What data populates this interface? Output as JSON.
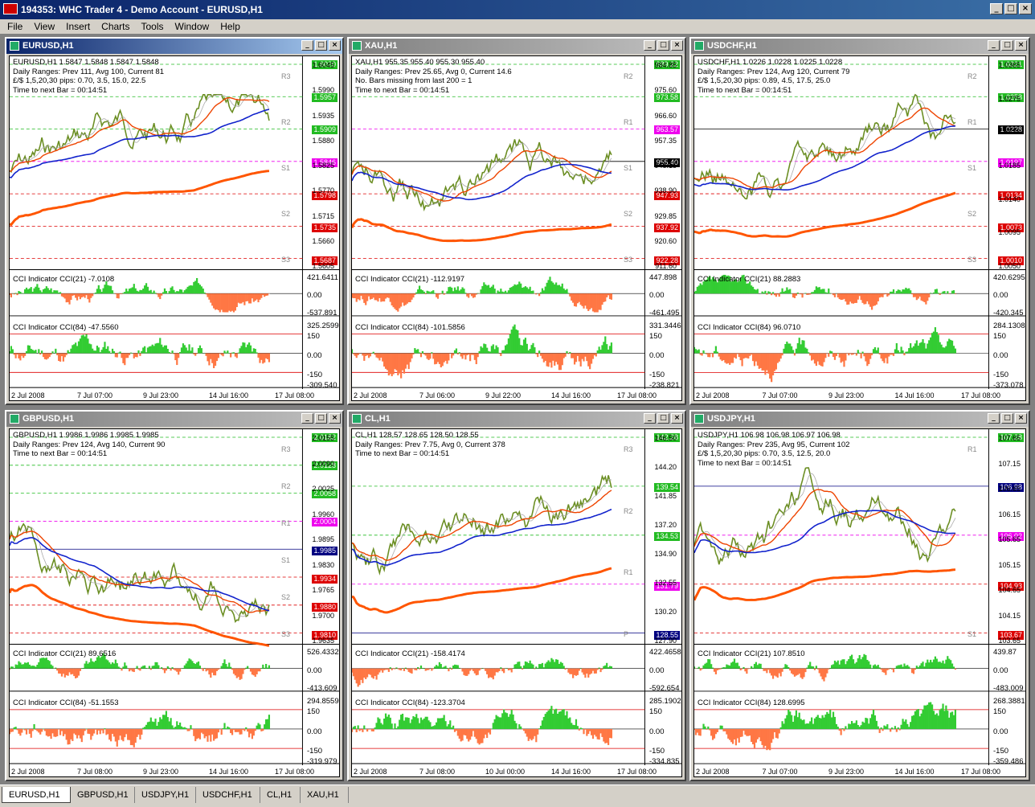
{
  "app": {
    "title": "194353: WHC Trader 4 - Demo Account - EURUSD,H1"
  },
  "menu": [
    "File",
    "View",
    "Insert",
    "Charts",
    "Tools",
    "Window",
    "Help"
  ],
  "tabs": [
    "EURUSD,H1",
    "GBPUSD,H1",
    "USDJPY,H1",
    "USDCHF,H1",
    "CL,H1",
    "XAU,H1"
  ],
  "charts": [
    {
      "title": "EURUSD,H1",
      "info": [
        "EURUSD,H1  1.5847 1.5848 1.5847 1.5848",
        "Daily Ranges:  Prev 111,  Avg 100,  Current 81",
        "£/$  1,5,20,30 pips:  0.70,  3.5,  15.0,  22.5",
        "Time to next Bar = 00:14:51"
      ],
      "yticks": [
        "1.6045",
        "1.5990",
        "1.5935",
        "1.5880",
        "1.5825",
        "1.5770",
        "1.5715",
        "1.5660",
        "1.5605"
      ],
      "levels": [
        {
          "v": "1.6020",
          "c": "#22bb22"
        },
        {
          "v": "1.5957",
          "c": "#22bb22"
        },
        {
          "v": "1.5909",
          "c": "#22bb22"
        },
        {
          "v": "1.5846",
          "c": "#ee00ee"
        },
        {
          "v": "1.5798",
          "c": "#dd0000"
        },
        {
          "v": "1.5735",
          "c": "#dd0000"
        },
        {
          "v": "1.5687",
          "c": "#dd0000"
        }
      ],
      "pivots": [
        "R3",
        "R2",
        "S1",
        "S2",
        "S3"
      ],
      "cci1": {
        "label": "CCI Indicator  CCI(21) -7.0108",
        "hi": "421.6411",
        "mid": "0.00",
        "lo": "-537.891"
      },
      "cci2": {
        "label": "CCI Indicator  CCI(84) -47.5560",
        "hi": "325.2599",
        "l150": "150",
        "mid": "0.00",
        "lm150": "-150",
        "lo": "-309.540"
      },
      "xticks": [
        "2 Jul 2008",
        "7 Jul 07:00",
        "9 Jul 23:00",
        "14 Jul 16:00",
        "17 Jul 08:00"
      ]
    },
    {
      "title": "XAU,H1",
      "info": [
        "XAU,H1  955.35 955.40 955.30 955.40",
        "Daily Ranges:  Prev 25.65,  Avg 0,  Current 14.6",
        "No. Bars missing from last 200 = 1",
        "Time to next Bar = 00:14:51"
      ],
      "yticks": [
        "984.85",
        "975.60",
        "966.60",
        "957.35",
        "948.15",
        "938.90",
        "929.85",
        "920.60",
        "911.60"
      ],
      "levels": [
        {
          "v": "989.22",
          "c": "#22bb22"
        },
        {
          "v": "973.58",
          "c": "#22bb22"
        },
        {
          "v": "963.57",
          "c": "#ee00ee"
        },
        {
          "v": "955.40",
          "c": "#000000"
        },
        {
          "v": "947.93",
          "c": "#dd0000"
        },
        {
          "v": "937.92",
          "c": "#dd0000"
        },
        {
          "v": "922.28",
          "c": "#dd0000"
        }
      ],
      "pivots": [
        "R2",
        "R1",
        "S1",
        "S2",
        "S3"
      ],
      "cci1": {
        "label": "CCI Indicator  CCI(21) -112.9197",
        "hi": "447.898",
        "mid": "0.00",
        "lo": "-461.495"
      },
      "cci2": {
        "label": "CCI Indicator  CCI(84) -101.5856",
        "hi": "331.3446",
        "l150": "150",
        "mid": "0.00",
        "lm150": "-150",
        "lo": "-238.821"
      },
      "xticks": [
        "2 Jul 2008",
        "7 Jul 06:00",
        "9 Jul 22:00",
        "14 Jul 16:00",
        "17 Jul 08:00"
      ]
    },
    {
      "title": "USDCHF,H1",
      "info": [
        "USDCHF,H1  1.0226 1.0228 1.0225 1.0228",
        "Daily Ranges:  Prev 124,  Avg 120,  Current 79",
        "£/$  1,5,20,30 pips:  0.89,  4.5,  17.5,  25.0",
        "Time to next Bar = 00:14:51"
      ],
      "yticks": [
        "1.0365",
        "1.0275",
        "1.0230",
        "1.0185",
        "1.0140",
        "1.0095",
        "1.0050"
      ],
      "levels": [
        {
          "v": "1.0321",
          "c": "#22bb22"
        },
        {
          "v": "1.0258",
          "c": "#22bb22"
        },
        {
          "v": "1.0228",
          "c": "#000000"
        },
        {
          "v": "1.0197",
          "c": "#ee00ee"
        },
        {
          "v": "1.0134",
          "c": "#dd0000"
        },
        {
          "v": "1.0073",
          "c": "#dd0000"
        },
        {
          "v": "1.0010",
          "c": "#dd0000"
        }
      ],
      "pivots": [
        "R2",
        "R1",
        "S1",
        "S2",
        "S3"
      ],
      "cci1": {
        "label": "CCI Indicator  CCI(21) 88.2883",
        "hi": "420.6295",
        "mid": "0.00",
        "lo": "-420.345"
      },
      "cci2": {
        "label": "CCI Indicator  CCI(84) 96.0710",
        "hi": "284.1308",
        "l150": "150",
        "mid": "0.00",
        "lm150": "-150",
        "lo": "-373.078"
      },
      "xticks": [
        "2 Jul 2008",
        "7 Jul 07:00",
        "9 Jul 23:00",
        "14 Jul 16:00",
        "17 Jul 08:00"
      ]
    },
    {
      "title": "GBPUSD,H1",
      "info": [
        "GBPUSD,H1  1.9986 1.9986 1.9985 1.9985",
        "Daily Ranges:  Prev 124,  Avg 140,  Current 90",
        "Time to next Bar = 00:14:51"
      ],
      "yticks": [
        "2.0155",
        "2.0090",
        "2.0025",
        "1.9960",
        "1.9895",
        "1.9830",
        "1.9765",
        "1.9700",
        "1.9635"
      ],
      "levels": [
        {
          "v": "2.0182",
          "c": "#22bb22"
        },
        {
          "v": "2.0128",
          "c": "#22bb22"
        },
        {
          "v": "2.0058",
          "c": "#22bb22"
        },
        {
          "v": "2.0004",
          "c": "#ee00ee"
        },
        {
          "v": "1.9985",
          "c": "#000080"
        },
        {
          "v": "1.9934",
          "c": "#dd0000"
        },
        {
          "v": "1.9880",
          "c": "#dd0000"
        },
        {
          "v": "1.9810",
          "c": "#dd0000"
        }
      ],
      "pivots": [
        "R3",
        "R2",
        "R1",
        "S1",
        "S2",
        "S3"
      ],
      "cci1": {
        "label": "CCI Indicator  CCI(21) 89.6516",
        "hi": "526.4332",
        "mid": "0.00",
        "lo": "-413.609"
      },
      "cci2": {
        "label": "CCI Indicator  CCI(84) -51.1553",
        "hi": "294.8559",
        "l150": "150",
        "mid": "0.00",
        "lm150": "-150",
        "lo": "-319.979"
      },
      "xticks": [
        "2 Jul 2008",
        "7 Jul 08:00",
        "9 Jul 23:00",
        "14 Jul 16:00",
        "17 Jul 08:00"
      ]
    },
    {
      "title": "CL,H1",
      "info": [
        "CL,H1  128.57 128.65 128.50 128.55",
        "Daily Ranges:  Prev 7.75,  Avg 0,  Current 378",
        "Time to next Bar = 00:14:51"
      ],
      "yticks": [
        "146.50",
        "144.20",
        "141.85",
        "137.20",
        "134.90",
        "132.55",
        "130.20",
        "127.90"
      ],
      "levels": [
        {
          "v": "142.28",
          "c": "#22bb22"
        },
        {
          "v": "139.54",
          "c": "#22bb22"
        },
        {
          "v": "134.53",
          "c": "#22bb22"
        },
        {
          "v": "131.79",
          "c": "#ee00ee"
        },
        {
          "v": "128.55",
          "c": "#000080"
        }
      ],
      "pivots": [
        "R3",
        "R2",
        "R1",
        "P"
      ],
      "cci1": {
        "label": "CCI Indicator  CCI(21) -158.4174",
        "hi": "422.4658",
        "mid": "0.00",
        "lo": "-592.654"
      },
      "cci2": {
        "label": "CCI Indicator  CCI(84) -123.3704",
        "hi": "285.1902",
        "l150": "150",
        "mid": "0.00",
        "lm150": "-150",
        "lo": "-334.835"
      },
      "xticks": [
        "2 Jul 2008",
        "7 Jul 08:00",
        "10 Jul 00:00",
        "14 Jul 16:00",
        "17 Jul 08:00"
      ]
    },
    {
      "title": "USDJPY,H1",
      "info": [
        "USDJPY,H1  106.98 106.98 106.97 106.98",
        "Daily Ranges:  Prev 235,  Avg 95,  Current 102",
        "£/$  1,5,20,30 pips:  0.70,  3.5,  12.5,  20.0",
        "Time to next Bar = 00:14:51"
      ],
      "yticks": [
        "107.65",
        "107.15",
        "106.65",
        "106.15",
        "105.65",
        "105.15",
        "104.65",
        "104.15",
        "103.65"
      ],
      "levels": [
        {
          "v": "107.28",
          "c": "#22bb22"
        },
        {
          "v": "106.98",
          "c": "#000080"
        },
        {
          "v": "106.02",
          "c": "#ee00ee"
        },
        {
          "v": "104.93",
          "c": "#dd0000"
        },
        {
          "v": "103.67",
          "c": "#dd0000"
        }
      ],
      "pivots": [
        "R1",
        "S1"
      ],
      "cci1": {
        "label": "CCI Indicator  CCI(21) 107.8510",
        "hi": "439.87",
        "mid": "0.00",
        "lo": "-483.009"
      },
      "cci2": {
        "label": "CCI Indicator  CCI(84) 128.6995",
        "hi": "268.3881",
        "l150": "150",
        "mid": "0.00",
        "lm150": "-150",
        "lo": "-359.486"
      },
      "xticks": [
        "2 Jul 2008",
        "7 Jul 07:00",
        "9 Jul 23:00",
        "14 Jul 16:00",
        "17 Jul 08:00"
      ]
    }
  ]
}
